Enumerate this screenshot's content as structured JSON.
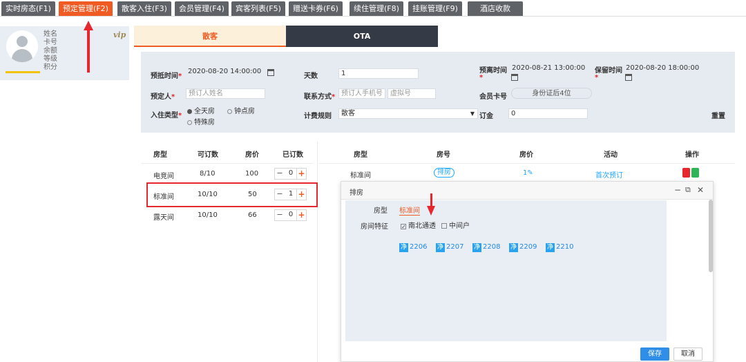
{
  "top_tabs": [
    {
      "label": "实时房态(F1)",
      "active": false
    },
    {
      "label": "预定管理(F2)",
      "active": true
    },
    {
      "label": "散客入住(F3)",
      "active": false
    },
    {
      "label": "会员管理(F4)",
      "active": false
    },
    {
      "label": "宾客列表(F5)",
      "active": false
    },
    {
      "label": "赠送卡券(F6)",
      "active": false
    },
    {
      "label": "续住管理(F8)",
      "active": false
    },
    {
      "label": "挂账管理(F9)",
      "active": false
    },
    {
      "label": "酒店收款",
      "active": false
    }
  ],
  "member": {
    "name_label": "姓名",
    "card_label": "卡号",
    "balance_label": "余额",
    "level_label": "等级",
    "points_label": "积分",
    "vip": "vip"
  },
  "sub_tabs": {
    "sk": "散客",
    "ota": "OTA"
  },
  "form": {
    "arrive_label": "预抵时间",
    "arrive_value": "2020-08-20 14:00:00",
    "days_label": "天数",
    "days_value": "1",
    "leave_label": "预离时间",
    "leave_value": "2020-08-21 13:00:00",
    "keep_label": "保留时间",
    "keep_value": "2020-08-20 18:00:00",
    "booker_label": "预定人",
    "booker_placeholder": "预订人姓名",
    "contact_label": "联系方式",
    "phone_placeholder": "预订人手机号",
    "virtual_placeholder": "虚拟号",
    "card_label": "会员卡号",
    "card_placeholder": "身份证后4位",
    "checkin_type_label": "入住类型",
    "type_full": "全天房",
    "type_hour": "钟点房",
    "type_special": "特殊房",
    "billing_label": "计费规则",
    "billing_value": "散客",
    "deposit_label": "订金",
    "deposit_value": "0",
    "reset_label": "重置"
  },
  "left_table": {
    "headers": [
      "房型",
      "可订数",
      "房价",
      "已订数"
    ],
    "rows": [
      {
        "type": "电竞间",
        "available": "8/10",
        "price": "100",
        "booked": "0"
      },
      {
        "type": "标准间",
        "available": "10/10",
        "price": "50",
        "booked": "1"
      },
      {
        "type": "露天间",
        "available": "10/10",
        "price": "66",
        "booked": "0"
      }
    ]
  },
  "right_table": {
    "headers": [
      "房型",
      "房号",
      "房价",
      "活动",
      "操作"
    ],
    "row": {
      "type": "标准间",
      "room_btn": "排房",
      "price": "1",
      "activity": "首次预订"
    }
  },
  "dialog": {
    "title": "排房",
    "room_type_label": "房型",
    "room_type_value": "标准间",
    "feature_label": "房间特征",
    "feature_1": "南北通透",
    "feature_2": "中间户",
    "rooms": [
      "2206",
      "2207",
      "2208",
      "2209",
      "2210"
    ],
    "room_badge": "净",
    "save": "保存",
    "cancel": "取消"
  },
  "colors": {
    "accent": "#f05a23",
    "dark_tab": "#5f6368",
    "link_blue": "#1ea7ff",
    "highlight_red": "#e8262d"
  }
}
